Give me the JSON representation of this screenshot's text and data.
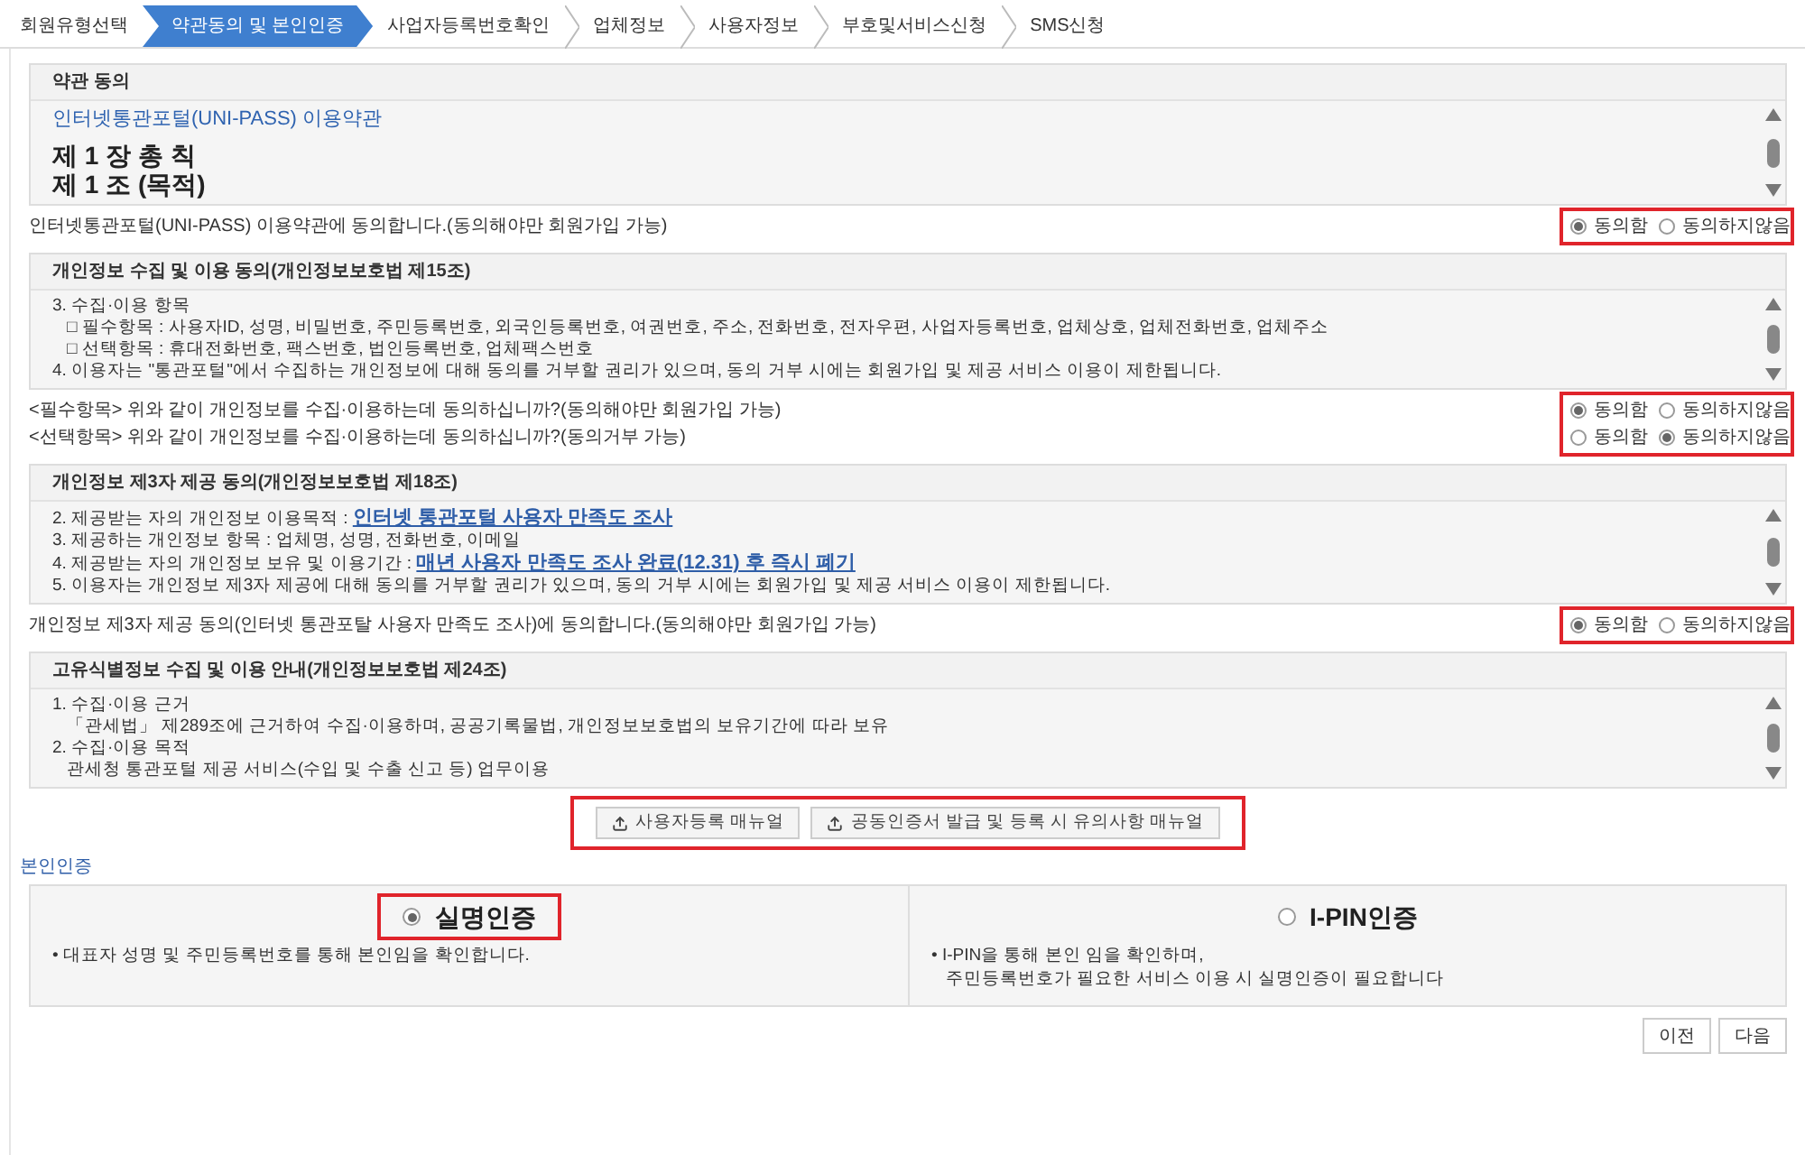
{
  "steps": [
    {
      "label": "회원유형선택",
      "selected": false
    },
    {
      "label": "약관동의 및 본인인증",
      "selected": true
    },
    {
      "label": "사업자등록번호확인",
      "selected": false
    },
    {
      "label": "업체정보",
      "selected": false
    },
    {
      "label": "사용자정보",
      "selected": false
    },
    {
      "label": "부호및서비스신청",
      "selected": false
    },
    {
      "label": "SMS신청",
      "selected": false
    }
  ],
  "sections": [
    {
      "title": "약관 동의",
      "lines": [
        {
          "kind": "title-link",
          "text": "인터넷통관포털(UNI-PASS) 이용약관"
        },
        {
          "kind": "heading",
          "text": "제 1 장 총 칙"
        },
        {
          "kind": "heading",
          "text": "제 1 조 (목적)"
        }
      ],
      "agreement": {
        "highlighted": true,
        "rows": [
          {
            "text": "인터넷통관포털(UNI-PASS) 이용약관에 동의합니다.(동의해야만 회원가입 가능)",
            "options": [
              {
                "label": "동의함",
                "selected": true
              },
              {
                "label": "동의하지않음",
                "selected": false
              }
            ]
          }
        ]
      }
    },
    {
      "title": "개인정보 수집 및 이용 동의(개인정보보호법 제15조)",
      "lines": [
        {
          "kind": "text",
          "text": "3. 수집·이용 항목"
        },
        {
          "kind": "indented",
          "text": "□ 필수항목 : 사용자ID, 성명, 비밀번호, 주민등록번호, 외국인등록번호, 여권번호, 주소, 전화번호, 전자우편, 사업자등록번호, 업체상호, 업체전화번호, 업체주소"
        },
        {
          "kind": "indented",
          "text": "□ 선택항목 : 휴대전화번호, 팩스번호, 법인등록번호, 업체팩스번호"
        },
        {
          "kind": "text",
          "text": "4. 이용자는 \"통관포털\"에서 수집하는 개인정보에 대해 동의를 거부할 권리가 있으며, 동의 거부 시에는 회원가입 및 제공 서비스 이용이 제한됩니다."
        }
      ],
      "agreement": {
        "highlighted": true,
        "rows": [
          {
            "text": "<필수항목> 위와 같이 개인정보를 수집·이용하는데 동의하십니까?(동의해야만 회원가입 가능)",
            "options": [
              {
                "label": "동의함",
                "selected": true
              },
              {
                "label": "동의하지않음",
                "selected": false
              }
            ]
          },
          {
            "text": "<선택항목> 위와 같이 개인정보를 수집·이용하는데 동의하십니까?(동의거부 가능)",
            "options": [
              {
                "label": "동의함",
                "selected": false
              },
              {
                "label": "동의하지않음",
                "selected": true
              }
            ]
          }
        ]
      }
    },
    {
      "title": "개인정보 제3자 제공 동의(개인정보보호법 제18조)",
      "lines": [
        {
          "kind": "text",
          "text": "2. 제공받는 자의 개인정보 이용목적 : ",
          "link": "인터넷 통관포털 사용자 만족도 조사"
        },
        {
          "kind": "text",
          "text": "3. 제공하는 개인정보 항목 : 업체명, 성명, 전화번호, 이메일"
        },
        {
          "kind": "text",
          "text": "4. 제공받는 자의 개인정보 보유 및 이용기간 : ",
          "link": "매년 사용자 만족도 조사 완료(12.31) 후 즉시 폐기"
        },
        {
          "kind": "text",
          "text": "5. 이용자는 개인정보 제3자 제공에 대해 동의를 거부할 권리가 있으며, 동의 거부 시에는 회원가입 및 제공 서비스 이용이 제한됩니다."
        }
      ],
      "agreement": {
        "highlighted": true,
        "rows": [
          {
            "text": "개인정보 제3자 제공 동의(인터넷 통관포탈 사용자 만족도 조사)에 동의합니다.(동의해야만 회원가입 가능)",
            "options": [
              {
                "label": "동의함",
                "selected": true
              },
              {
                "label": "동의하지않음",
                "selected": false
              }
            ]
          }
        ]
      }
    },
    {
      "title": "고유식별정보 수집 및 이용 안내(개인정보보호법 제24조)",
      "lines": [
        {
          "kind": "text",
          "text": "1. 수집·이용 근거"
        },
        {
          "kind": "indented",
          "text": "「관세법」 제289조에 근거하여 수집·이용하며, 공공기록물법, 개인정보보호법의 보유기간에 따라 보유"
        },
        {
          "kind": "text",
          "text": "2. 수집·이용 목적"
        },
        {
          "kind": "indented",
          "text": "관세청 통관포털 제공 서비스(수입 및 수출 신고 등) 업무이용"
        }
      ]
    }
  ],
  "manuals": {
    "highlighted": true,
    "buttons": [
      "사용자등록 매뉴얼",
      "공동인증서 발급 및 등록 시 유의사항 매뉴얼"
    ]
  },
  "identity": {
    "title": "본인인증",
    "options": [
      {
        "label": "실명인증",
        "selected": true,
        "highlighted": true,
        "notes": [
          "• 대표자 성명 및 주민등록번호를 통해 본인임을 확인합니다."
        ]
      },
      {
        "label": "I-PIN인증",
        "selected": false,
        "highlighted": false,
        "notes": [
          "• I-PIN을 통해 본인 임을 확인하며,",
          "주민등록번호가 필요한 서비스 이용 시 실명인증이 필요합니다"
        ]
      }
    ]
  },
  "nav_buttons": [
    "이전",
    "다음"
  ]
}
